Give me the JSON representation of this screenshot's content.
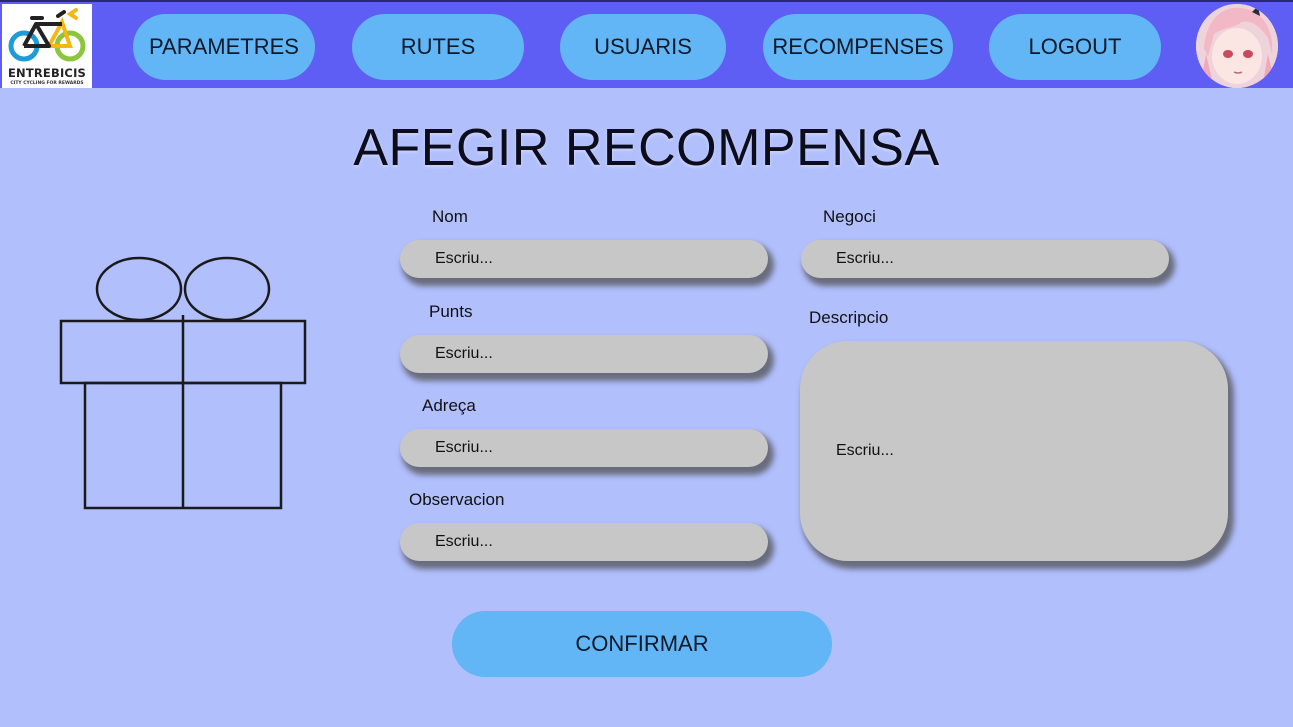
{
  "logo": {
    "name": "ENTREBICIS",
    "tagline": "CITY CYCLING FOR REWARDS"
  },
  "nav": {
    "items": [
      {
        "label": "PARAMETRES"
      },
      {
        "label": "RUTES"
      },
      {
        "label": "USUARIS"
      },
      {
        "label": "RECOMPENSES"
      },
      {
        "label": "LOGOUT"
      }
    ]
  },
  "page": {
    "title": "AFEGIR RECOMPENSA"
  },
  "form": {
    "nom": {
      "label": "Nom",
      "placeholder": "Escriu..."
    },
    "negoci": {
      "label": "Negoci",
      "placeholder": "Escriu..."
    },
    "punts": {
      "label": "Punts",
      "placeholder": "Escriu..."
    },
    "descripcio": {
      "label": "Descripcio",
      "placeholder": "Escriu..."
    },
    "adreca": {
      "label": "Adreça",
      "placeholder": "Escriu..."
    },
    "observacion": {
      "label": "Observacion",
      "placeholder": "Escriu..."
    },
    "confirm_label": "CONFIRMAR"
  },
  "colors": {
    "background": "#b1bffd",
    "navbar": "#5e5ef5",
    "button": "#63b6f5",
    "field": "#c7c7c7"
  },
  "icons": {
    "logo": "bicycle-logo-icon",
    "avatar": "user-avatar",
    "illustration": "gift-icon"
  }
}
